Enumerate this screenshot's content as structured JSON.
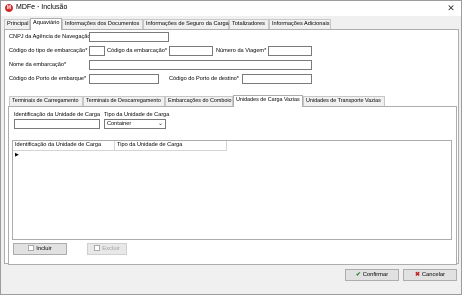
{
  "window": {
    "title": "MDFe - Inclusão",
    "app_icon": "mdfe-logo-icon"
  },
  "main_tabs": [
    {
      "label": "Principal"
    },
    {
      "label": "Aquaviário"
    },
    {
      "label": "Informações dos Documentos"
    },
    {
      "label": "Informações de Seguro da Carga"
    },
    {
      "label": "Totalizadores"
    },
    {
      "label": "Informações Adicionais"
    }
  ],
  "active_main_tab": "Aquaviário",
  "form": {
    "cnpj_label": "CNPJ da Agência de Navegação*",
    "cnpj_value": "",
    "tipo_embarcacao_label": "Código do tipo de embarcação*",
    "tipo_embarcacao_value": "",
    "codigo_embarcacao_label": "Código da embarcação*",
    "codigo_embarcacao_value": "",
    "numero_viagem_label": "Número da Viagem*",
    "numero_viagem_value": "",
    "nome_embarcacao_label": "Nome da embarcação*",
    "nome_embarcacao_value": "",
    "porto_embarque_label": "Código do Porto de embarque*",
    "porto_embarque_value": "",
    "porto_destino_label": "Código do Porto de destino*",
    "porto_destino_value": ""
  },
  "sub_tabs": [
    {
      "label": "Terminais de Carregamento"
    },
    {
      "label": "Terminais de Descarregamento"
    },
    {
      "label": "Embarcações do Comboio"
    },
    {
      "label": "Unidades de Carga Vazias"
    },
    {
      "label": "Unidades de Transporte Vazias"
    }
  ],
  "active_sub_tab": "Unidades de Carga Vazias",
  "unidade_carga": {
    "id_label": "Identificação da Unidade de Carga",
    "id_value": "",
    "tipo_label": "Tipo da Unidade de Carga",
    "tipo_selected": "Container"
  },
  "grid": {
    "columns": [
      "Identificação da Unidade de Carga",
      "Tipo da Unidade de Carga"
    ],
    "rows": [],
    "row_indicator": "▶"
  },
  "buttons": {
    "incluir": "Incluir",
    "excluir": "Excluir",
    "confirmar": "Confirmar",
    "cancelar": "Cancelar"
  }
}
